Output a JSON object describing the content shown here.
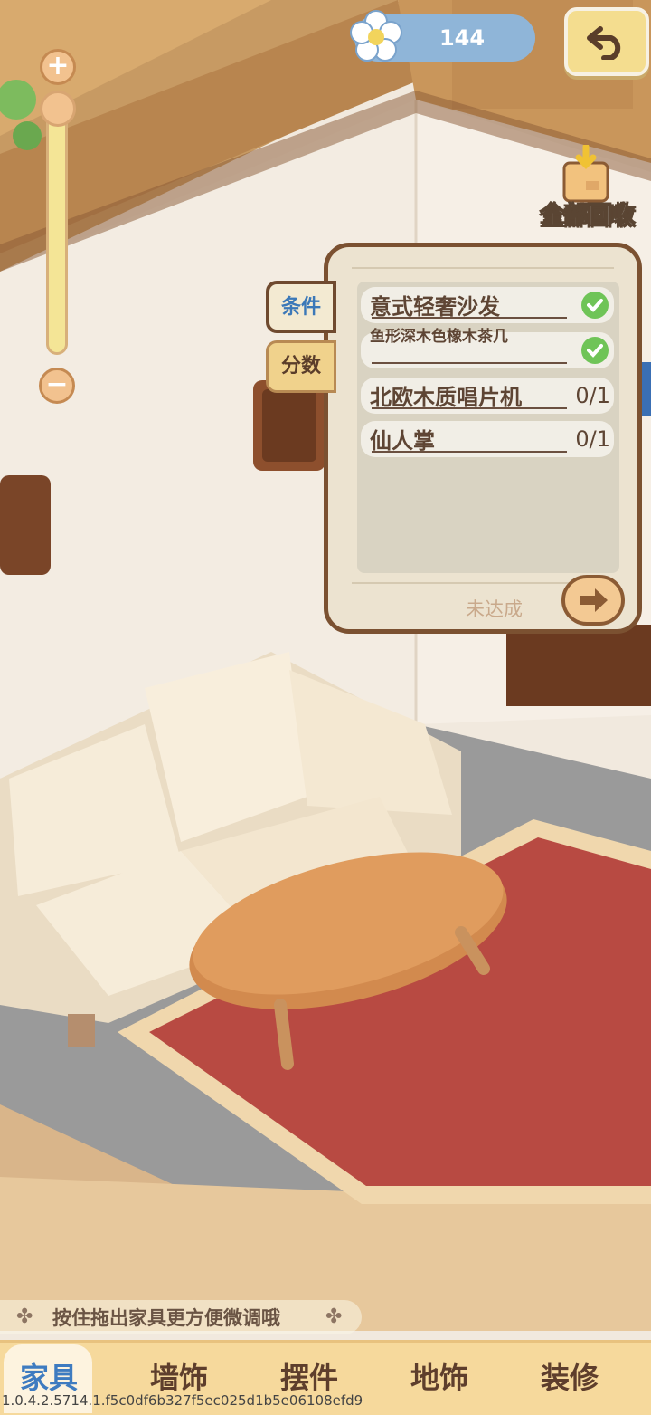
{
  "top_bar": {
    "currency_icon": "flower-icon",
    "currency_value": "144",
    "back_icon": "undo-arrow-icon"
  },
  "recycle": {
    "icon": "bag-down-arrow-icon",
    "label": "全部回收"
  },
  "zoom": {
    "plus_label": "+",
    "minus_label": "−",
    "level": 1.0
  },
  "side_tabs": [
    {
      "label": "条件",
      "active": true
    },
    {
      "label": "分数",
      "active": false
    }
  ],
  "requirements": {
    "items": [
      {
        "name": "意式轻奢沙发",
        "done": true
      },
      {
        "name": "鱼形深木色橡木茶几",
        "done": true
      },
      {
        "name": "北欧木质唱片机",
        "done": false,
        "progress": "0/1"
      },
      {
        "name": "仙人掌",
        "done": false,
        "progress": "0/1"
      }
    ],
    "status": "未达成",
    "go_icon": "arrow-right-icon"
  },
  "hint": {
    "text": "按住拖出家具更方便微调哦"
  },
  "bottom_nav": {
    "items": [
      "家具",
      "墙饰",
      "摆件",
      "地饰",
      "装修"
    ],
    "active_index": 0
  },
  "version": "1.0.4.2.5714.1.f5c0df6b327f5ec025d1b5e06108efd9",
  "colors": {
    "accent_blue": "#3e7bc0",
    "check_green": "#6fc457",
    "rug_red": "#b84a42",
    "panel_border": "#7b5131"
  }
}
